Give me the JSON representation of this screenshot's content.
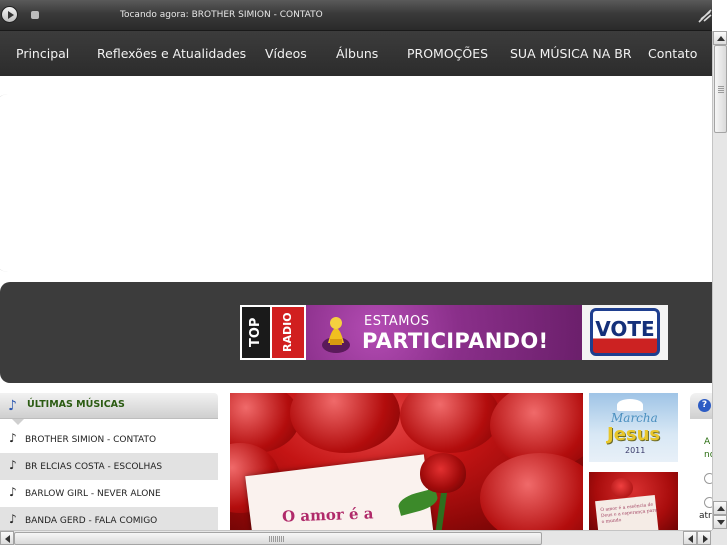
{
  "player": {
    "now_playing": "Tocando agora: BROTHER SIMION - CONTATO",
    "play_icon": "play-icon",
    "stop_icon": "stop-icon",
    "volume_icon": "volume-icon"
  },
  "nav": {
    "items": [
      {
        "label": "Principal"
      },
      {
        "label": "Reflexões e Atualidades"
      },
      {
        "label": "Vídeos"
      },
      {
        "label": "Álbuns"
      },
      {
        "label": "PROMOÇÕES"
      },
      {
        "label": "SUA MÚSICA NA BR"
      },
      {
        "label": "Contato"
      }
    ]
  },
  "ad": {
    "logo_top": "TOP",
    "logo_radio": "RADIO",
    "line1": "ESTAMOS",
    "line2": "PARTICIPANDO!",
    "vote": "VOTE",
    "colors": {
      "purple": "#8a2f8a",
      "red": "#d11f1f",
      "blue": "#14307a"
    }
  },
  "sidebar": {
    "title": "ÚLTIMAS MÚSICAS",
    "title_color": "#2b5b12",
    "songs": [
      {
        "label": "BROTHER SIMION - CONTATO"
      },
      {
        "label": "BR ELCIAS COSTA - ESCOLHAS"
      },
      {
        "label": "BARLOW GIRL - NEVER ALONE"
      },
      {
        "label": "BANDA GERD - FALA COMIGO"
      }
    ]
  },
  "main": {
    "photo_caption": "O amor é a",
    "thumb1": {
      "line1": "Marcha",
      "line2": "Jesus",
      "line3": "2011"
    },
    "thumb2": {
      "text": "O amor é a essência de Deus e a esperança para o mundo"
    }
  },
  "right_widget": {
    "help_icon": "?",
    "text1": "A",
    "text2": "no",
    "text3": "atr"
  }
}
